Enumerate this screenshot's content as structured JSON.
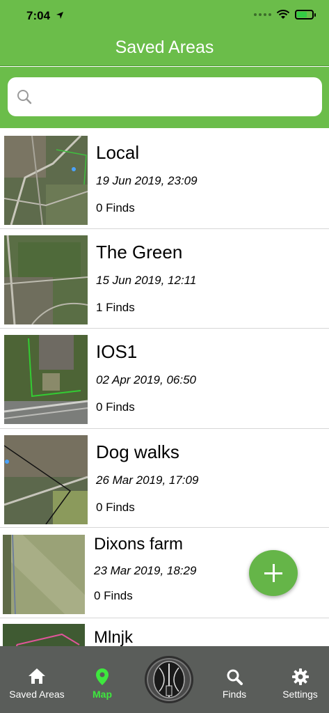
{
  "status_bar": {
    "time": "7:04"
  },
  "nav": {
    "title": "Saved Areas"
  },
  "search": {
    "placeholder": "",
    "value": ""
  },
  "areas": [
    {
      "name": "Local",
      "date": "19 Jun 2019, 23:09",
      "finds": "0 Finds"
    },
    {
      "name": "The Green",
      "date": "15 Jun 2019, 12:11",
      "finds": "1 Finds"
    },
    {
      "name": "IOS1",
      "date": "02 Apr 2019, 06:50",
      "finds": "0 Finds"
    },
    {
      "name": "Dog walks",
      "date": "26 Mar 2019, 17:09",
      "finds": "0 Finds"
    },
    {
      "name": "Dixons farm",
      "date": "23 Mar 2019, 18:29",
      "finds": "0 Finds"
    },
    {
      "name": "Mlnjk",
      "date": "",
      "finds": ""
    }
  ],
  "tabs": {
    "saved_areas": "Saved Areas",
    "map": "Map",
    "finds": "Finds",
    "settings": "Settings"
  },
  "colors": {
    "brand_green": "#6bbd4a",
    "active_tab": "#3ee83e",
    "tabbar": "#5a5d5a"
  },
  "icons": [
    "location-arrow-icon",
    "wifi-icon",
    "battery-icon",
    "search-icon",
    "home-icon",
    "map-pin-icon",
    "detector-icon",
    "magnifier-icon",
    "gear-icon",
    "add-icon"
  ]
}
